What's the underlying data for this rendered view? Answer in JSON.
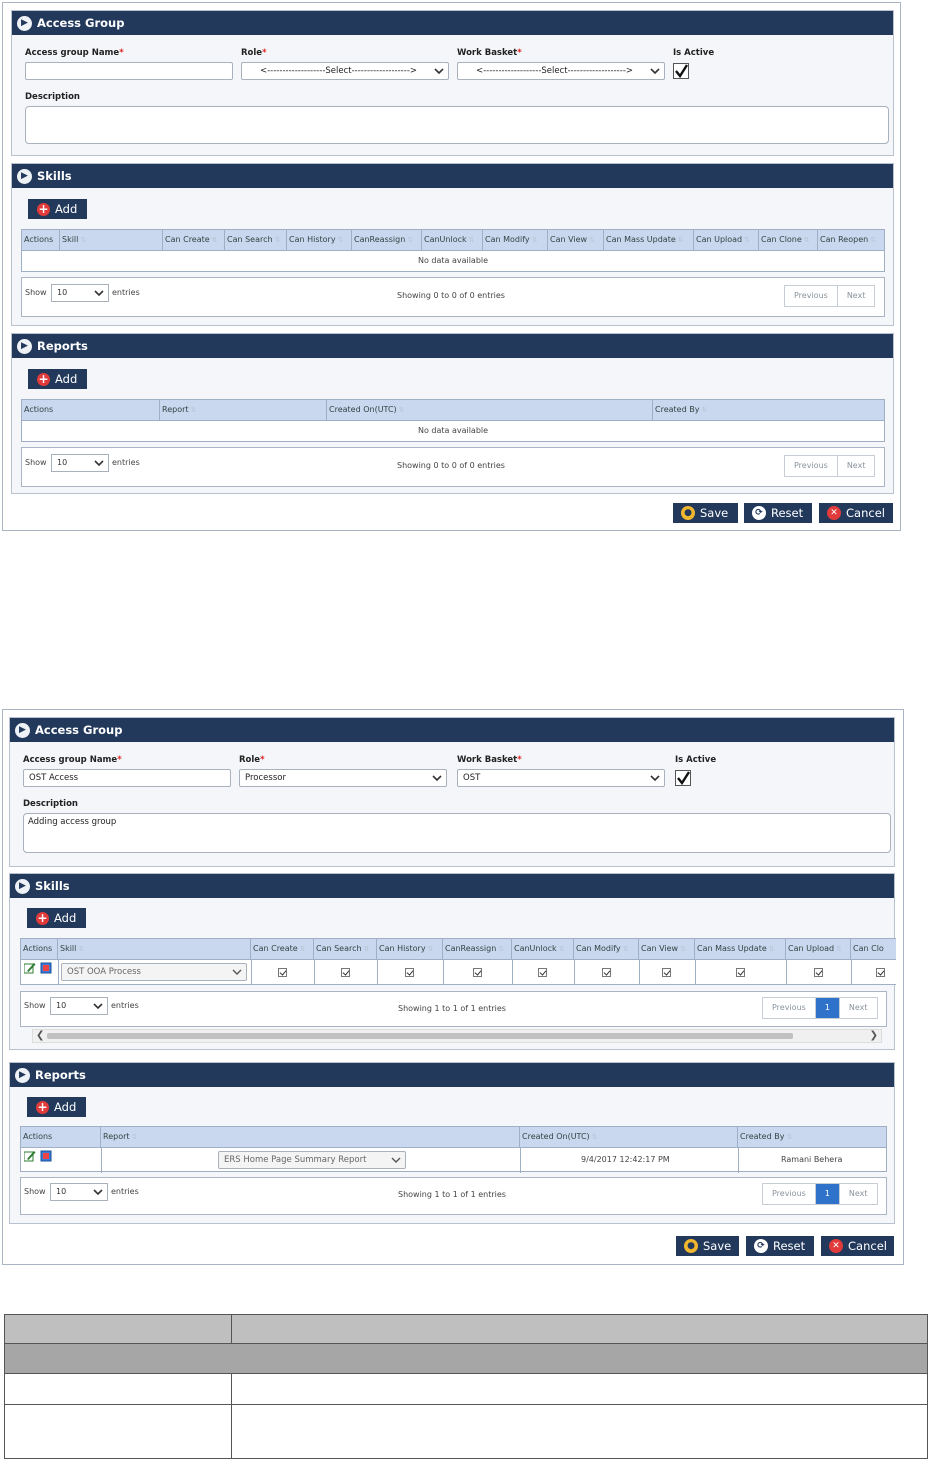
{
  "top": {
    "title": "Access Group",
    "form": {
      "name_label": "Access group Name",
      "name_value": "",
      "role_label": "Role",
      "role_value": "<-------------------Select------------------->",
      "wb_label": "Work Basket",
      "wb_value": "<-------------------Select------------------->",
      "active_label": "Is Active",
      "active_checked": true,
      "desc_label": "Description",
      "desc_value": ""
    },
    "skills": {
      "title": "Skills",
      "add": "Add",
      "columns": [
        "Actions",
        "Skill",
        "Can Create",
        "Can Search",
        "Can History",
        "CanReassign",
        "CanUnlock",
        "Can Modify",
        "Can View",
        "Can Mass Update",
        "Can Upload",
        "Can Clone",
        "Can Reopen"
      ],
      "empty": "No data available",
      "show": "Show",
      "show_value": "10",
      "entries": "entries",
      "info": "Showing 0 to 0 of 0 entries",
      "prev": "Previous",
      "next": "Next"
    },
    "reports": {
      "title": "Reports",
      "add": "Add",
      "columns": [
        "Actions",
        "Report",
        "Created On(UTC)",
        "Created By"
      ],
      "empty": "No data available",
      "show": "Show",
      "show_value": "10",
      "entries": "entries",
      "info": "Showing 0 to 0 of 0 entries",
      "prev": "Previous",
      "next": "Next"
    },
    "buttons": {
      "save": "Save",
      "reset": "Reset",
      "cancel": "Cancel"
    }
  },
  "bottom": {
    "title": "Access Group",
    "form": {
      "name_label": "Access group Name",
      "name_value": "OST Access",
      "role_label": "Role",
      "role_value": "Processor",
      "wb_label": "Work Basket",
      "wb_value": "OST",
      "active_label": "Is Active",
      "active_checked": true,
      "desc_label": "Description",
      "desc_value": "Adding access group"
    },
    "skills": {
      "title": "Skills",
      "add": "Add",
      "columns": [
        "Actions",
        "Skill",
        "Can Create",
        "Can Search",
        "Can History",
        "CanReassign",
        "CanUnlock",
        "Can Modify",
        "Can View",
        "Can Mass Update",
        "Can Upload",
        "Can Clo"
      ],
      "row_skill": "OST OOA Process",
      "show": "Show",
      "show_value": "10",
      "entries": "entries",
      "info": "Showing 1 to 1 of 1 entries",
      "prev": "Previous",
      "page": "1",
      "next": "Next"
    },
    "reports": {
      "title": "Reports",
      "add": "Add",
      "columns": [
        "Actions",
        "Report",
        "Created On(UTC)",
        "Created By"
      ],
      "row_report": "ERS Home Page Summary Report",
      "row_created_on": "9/4/2017 12:42:17 PM",
      "row_created_by": "Ramani Behera",
      "show": "Show",
      "show_value": "10",
      "entries": "entries",
      "info": "Showing 1 to 1 of 1 entries",
      "prev": "Previous",
      "page": "1",
      "next": "Next"
    },
    "buttons": {
      "save": "Save",
      "reset": "Reset",
      "cancel": "Cancel"
    }
  },
  "colors": {
    "header_navy": "#22395c",
    "grid_header": "#c9d8ee",
    "page_active": "#2f72c9",
    "cancel_red": "#e03a3a"
  },
  "icons": [
    "access-group-icon",
    "plus-icon",
    "chevron-down-icon",
    "checkmark-icon",
    "save-icon",
    "reset-icon",
    "cancel-icon",
    "edit-icon",
    "delete-icon",
    "sort-icon"
  ]
}
